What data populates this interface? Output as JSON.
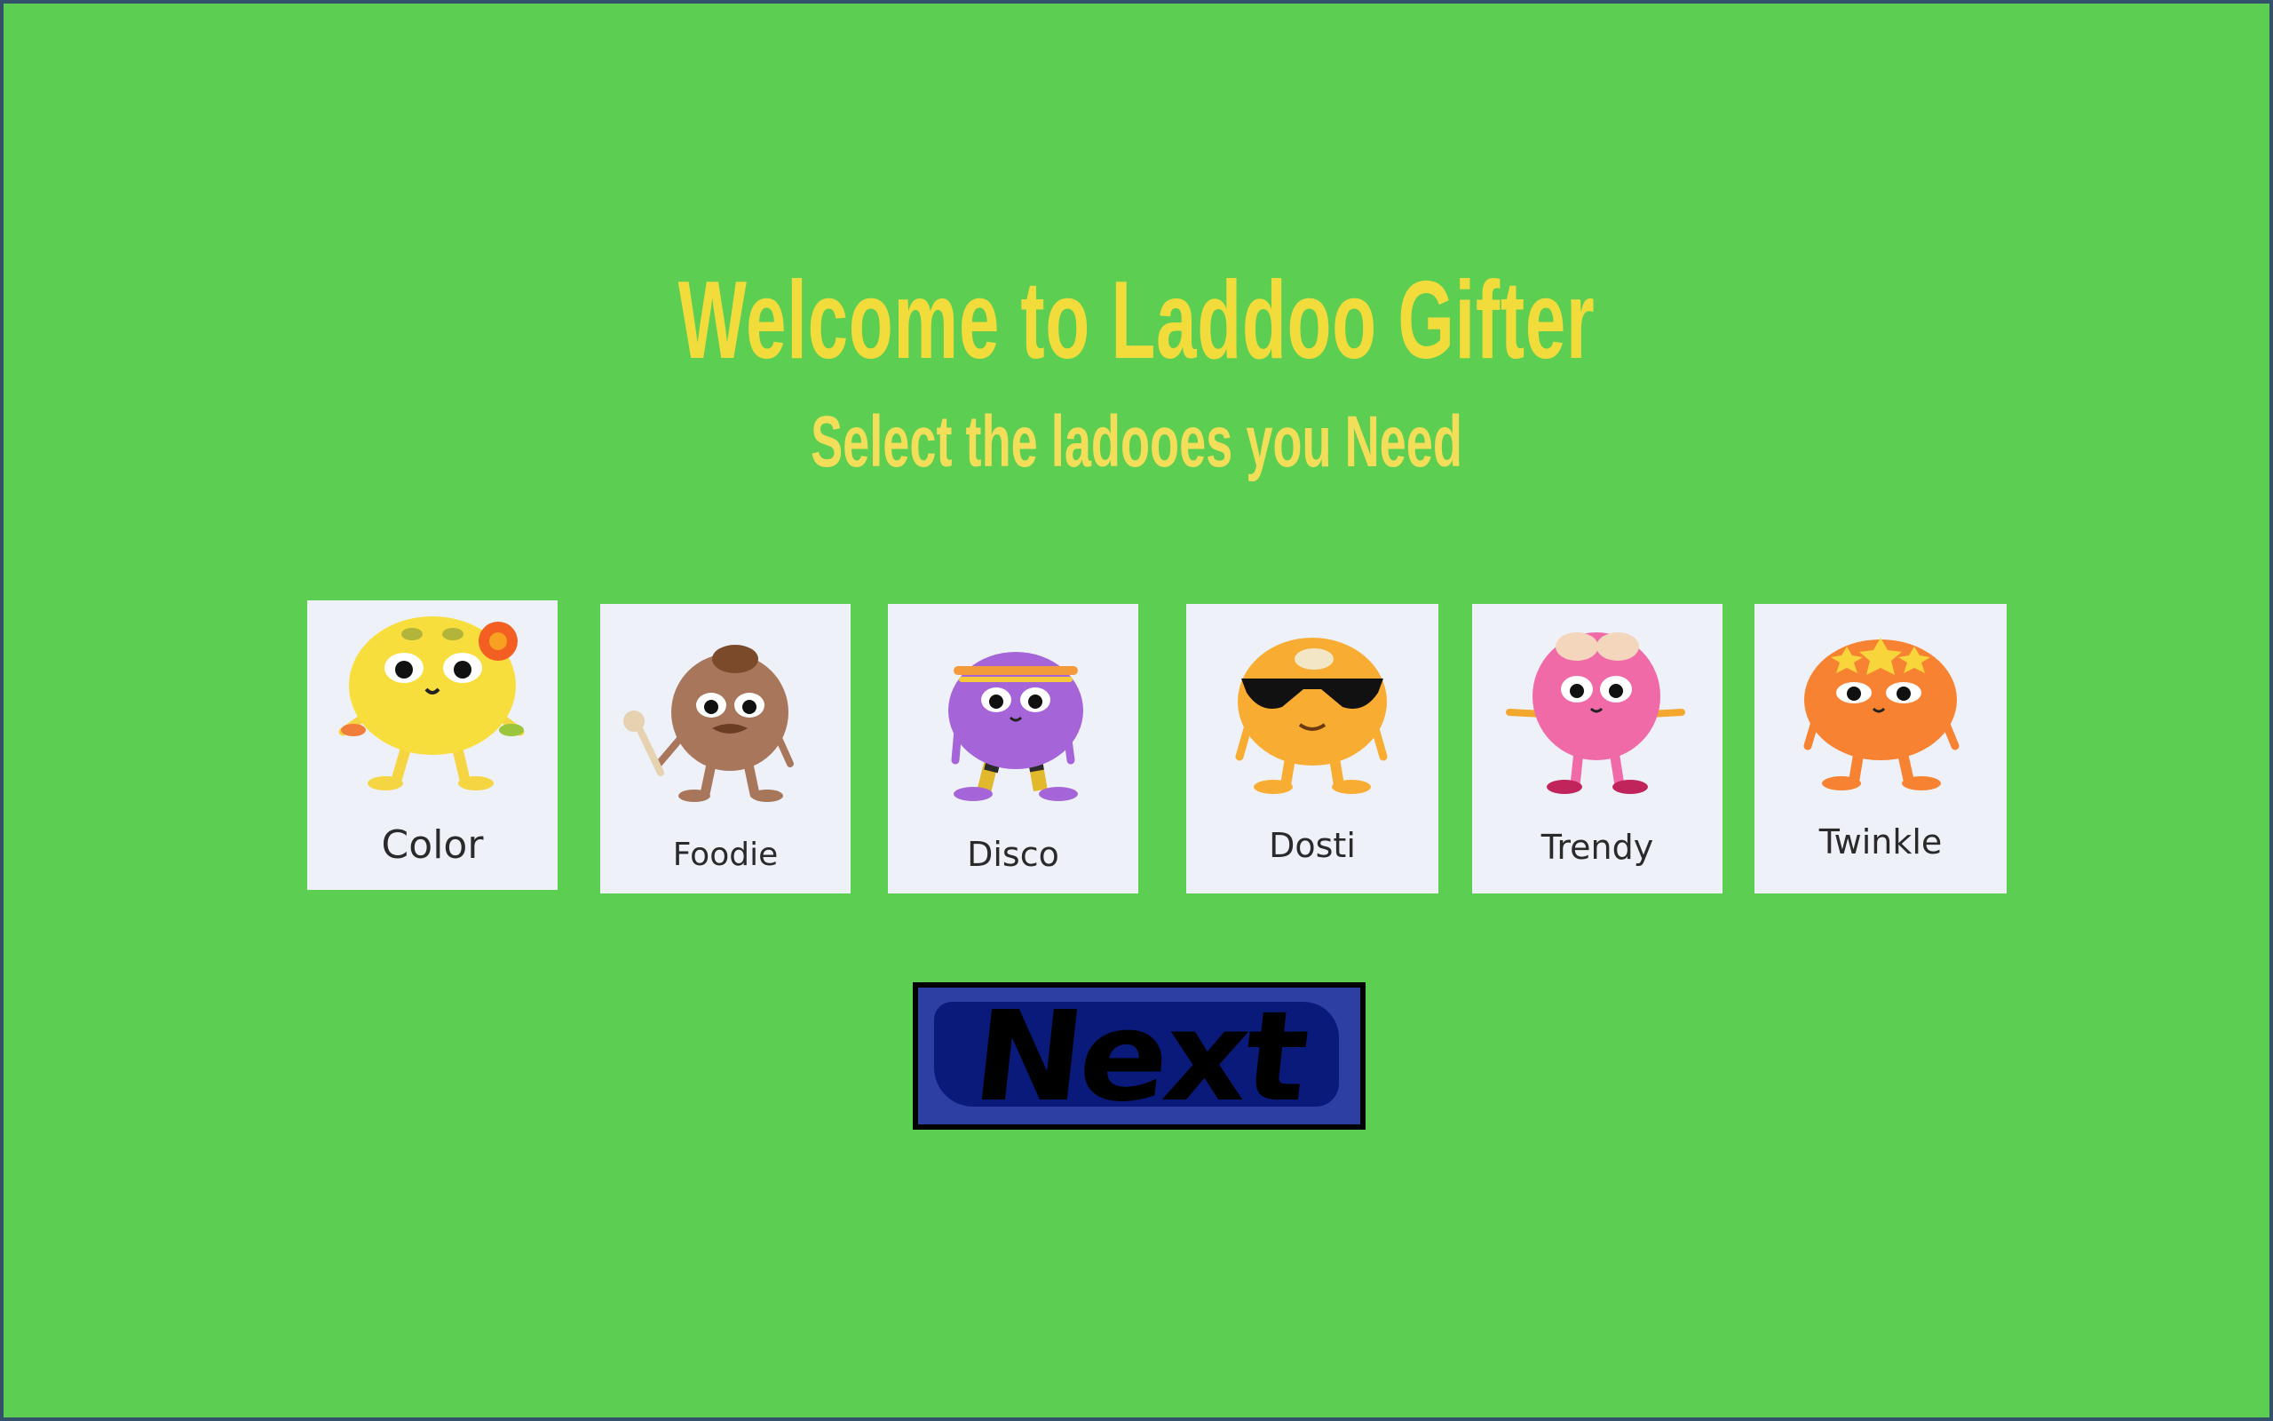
{
  "header": {
    "title": "Welcome to Laddoo Gifter",
    "subtitle": "Select the ladooes you Need"
  },
  "ladoos": [
    {
      "label": "Color",
      "icon": "yellow-ladoo-icon",
      "color": "#f8de3c"
    },
    {
      "label": "Foodie",
      "icon": "brown-ladoo-icon",
      "color": "#a8765a"
    },
    {
      "label": "Disco",
      "icon": "purple-ladoo-icon",
      "color": "#a565d8"
    },
    {
      "label": "Dosti",
      "icon": "orange-ladoo-sunglasses-icon",
      "color": "#f8ac32"
    },
    {
      "label": "Trendy",
      "icon": "pink-ladoo-icon",
      "color": "#f06aa8"
    },
    {
      "label": "Twinkle",
      "icon": "orange-ladoo-star-icon",
      "color": "#f78231"
    }
  ],
  "next_button": {
    "label": "Next"
  },
  "colors": {
    "background": "#5cce52",
    "title": "#f2dc3c",
    "card": "#eef2f8",
    "button": "#2e3fa4"
  }
}
